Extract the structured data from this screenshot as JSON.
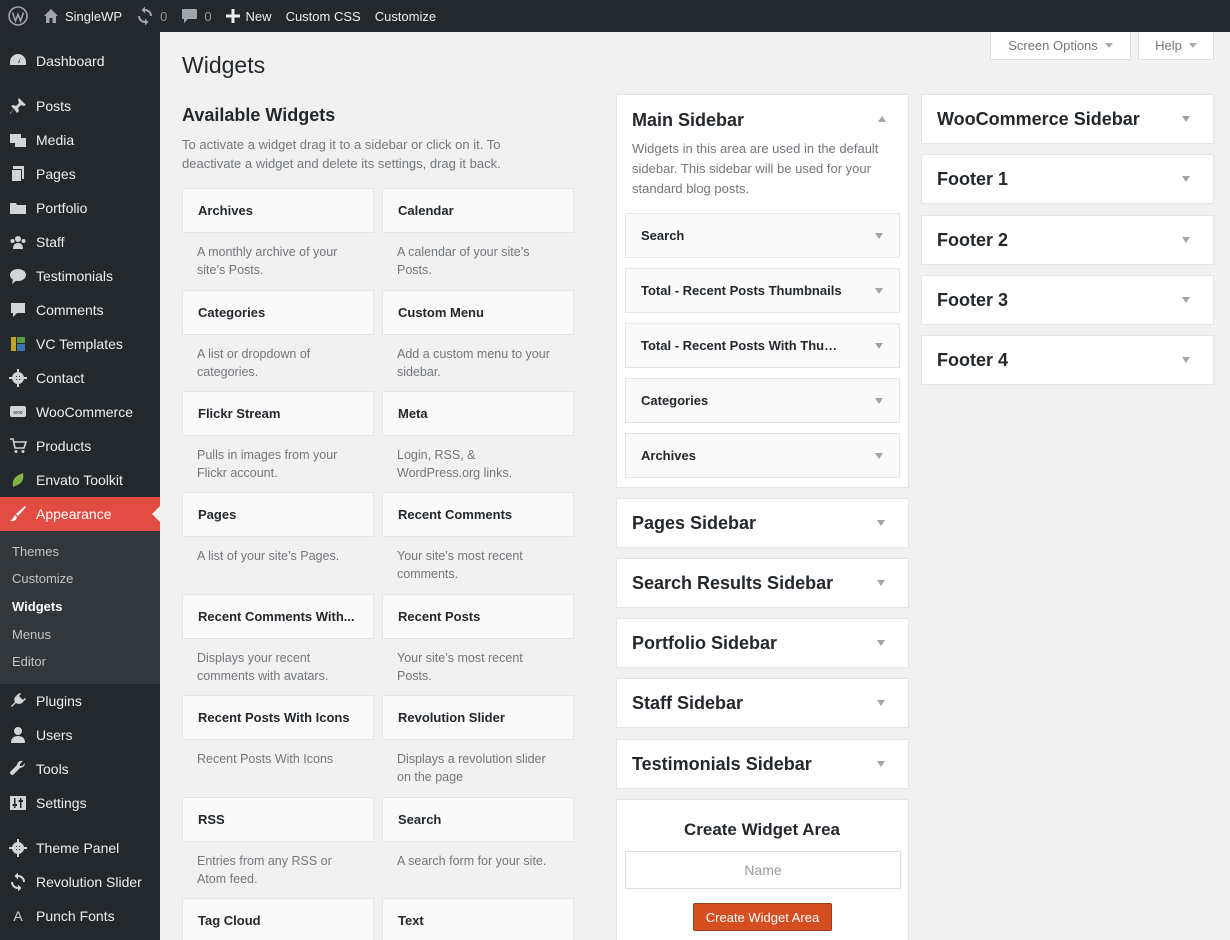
{
  "adminbar": {
    "site_name": "SingleWP",
    "updates_count": "0",
    "comments_count": "0",
    "new_label": "New",
    "custom_css_label": "Custom CSS",
    "customize_label": "Customize"
  },
  "menu": {
    "items": [
      {
        "label": "Dashboard",
        "icon": "dashboard-icon"
      },
      {
        "label": "Posts",
        "icon": "pin-icon"
      },
      {
        "label": "Media",
        "icon": "media-icon"
      },
      {
        "label": "Pages",
        "icon": "page-icon"
      },
      {
        "label": "Portfolio",
        "icon": "folder-icon"
      },
      {
        "label": "Staff",
        "icon": "groups-icon"
      },
      {
        "label": "Testimonials",
        "icon": "speech-bubbles-icon"
      },
      {
        "label": "Comments",
        "icon": "comment-icon"
      },
      {
        "label": "VC Templates",
        "icon": "layout-icon"
      },
      {
        "label": "Contact",
        "icon": "gear-icon"
      },
      {
        "label": "WooCommerce",
        "icon": "woo-icon"
      },
      {
        "label": "Products",
        "icon": "cart-icon"
      },
      {
        "label": "Envato Toolkit",
        "icon": "leaf-icon"
      },
      {
        "label": "Appearance",
        "icon": "paintbrush-icon"
      },
      {
        "label": "Plugins",
        "icon": "plug-icon"
      },
      {
        "label": "Users",
        "icon": "user-icon"
      },
      {
        "label": "Tools",
        "icon": "wrench-icon"
      },
      {
        "label": "Settings",
        "icon": "sliders-icon"
      },
      {
        "label": "Theme Panel",
        "icon": "gear-icon"
      },
      {
        "label": "Revolution Slider",
        "icon": "refresh-icon"
      },
      {
        "label": "Punch Fonts",
        "icon": "font-icon"
      }
    ],
    "submenu": [
      "Themes",
      "Customize",
      "Widgets",
      "Menus",
      "Editor"
    ]
  },
  "screen_options_label": "Screen Options",
  "help_label": "Help",
  "page_title": "Widgets",
  "available": {
    "title": "Available Widgets",
    "description": "To activate a widget drag it to a sidebar or click on it. To deactivate a widget and delete its settings, drag it back.",
    "widgets": [
      {
        "title": "Archives",
        "desc": "A monthly archive of your site’s Posts."
      },
      {
        "title": "Calendar",
        "desc": "A calendar of your site’s Posts."
      },
      {
        "title": "Categories",
        "desc": "A list or dropdown of categories."
      },
      {
        "title": "Custom Menu",
        "desc": "Add a custom menu to your sidebar."
      },
      {
        "title": "Flickr Stream",
        "desc": "Pulls in images from your Flickr account."
      },
      {
        "title": "Meta",
        "desc": "Login, RSS, & WordPress.org links."
      },
      {
        "title": "Pages",
        "desc": "A list of your site’s Pages."
      },
      {
        "title": "Recent Comments",
        "desc": "Your site’s most recent comments."
      },
      {
        "title": "Recent Comments With...",
        "desc": "Displays your recent comments with avatars."
      },
      {
        "title": "Recent Posts",
        "desc": "Your site’s most recent Posts."
      },
      {
        "title": "Recent Posts With Icons",
        "desc": "Recent Posts With Icons"
      },
      {
        "title": "Revolution Slider",
        "desc": "Displays a revolution slider on the page"
      },
      {
        "title": "RSS",
        "desc": "Entries from any RSS or Atom feed."
      },
      {
        "title": "Search",
        "desc": "A search form for your site."
      },
      {
        "title": "Tag Cloud",
        "desc": ""
      },
      {
        "title": "Text",
        "desc": ""
      }
    ]
  },
  "main_sidebar": {
    "title": "Main Sidebar",
    "description": "Widgets in this area are used in the default sidebar. This sidebar will be used for your standard blog posts.",
    "widgets": [
      "Search",
      "Total - Recent Posts Thumbnails",
      "Total - Recent Posts With Thumbnails",
      "Categories",
      "Archives"
    ]
  },
  "middle_sidebars": [
    "Pages Sidebar",
    "Search Results Sidebar",
    "Portfolio Sidebar",
    "Staff Sidebar",
    "Testimonials Sidebar"
  ],
  "right_sidebars": [
    "WooCommerce Sidebar",
    "Footer 1",
    "Footer 2",
    "Footer 3",
    "Footer 4"
  ],
  "create_area": {
    "title": "Create Widget Area",
    "placeholder": "Name",
    "button_label": "Create Widget Area"
  },
  "colors": {
    "adminbar_bg": "#23282d",
    "menu_bg": "#23282d",
    "submenu_bg": "#32373c",
    "accent": "#e14d43",
    "button": "#d54e21"
  }
}
